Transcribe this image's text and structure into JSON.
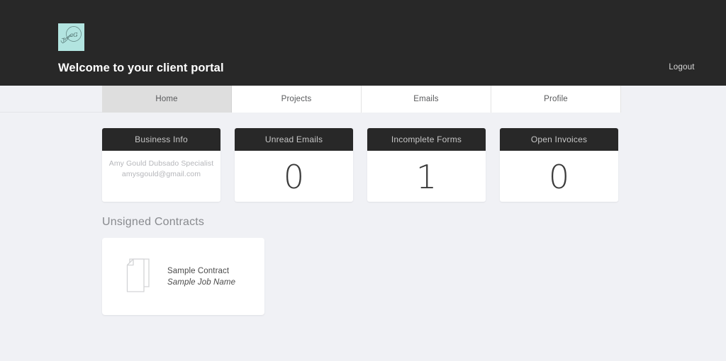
{
  "header": {
    "title": "Welcome to your client portal",
    "logout_label": "Logout",
    "logo_icon": "monogram-ag-leaf-logo",
    "logo_bg": "#b2e4e0",
    "bar_bg": "#282828"
  },
  "tabs": [
    {
      "label": "Home",
      "active": true
    },
    {
      "label": "Projects",
      "active": false
    },
    {
      "label": "Emails",
      "active": false
    },
    {
      "label": "Profile",
      "active": false
    }
  ],
  "stat_cards": [
    {
      "title": "Business Info",
      "type": "text",
      "lines": [
        "Amy Gould Dubsado Specialist",
        "amysgould@gmail.com"
      ]
    },
    {
      "title": "Unread Emails",
      "type": "value",
      "value": "0"
    },
    {
      "title": "Incomplete Forms",
      "type": "value",
      "value": "1"
    },
    {
      "title": "Open Invoices",
      "type": "value",
      "value": "0"
    }
  ],
  "contracts_section": {
    "title": "Unsigned Contracts",
    "items": [
      {
        "name": "Sample Contract",
        "job": "Sample Job Name",
        "icon": "documents-stack-icon"
      }
    ]
  },
  "colors": {
    "page_bg": "#f0f1f5",
    "dark": "#282828",
    "active_tab": "#dedede",
    "accent": "#b2e4e0"
  }
}
